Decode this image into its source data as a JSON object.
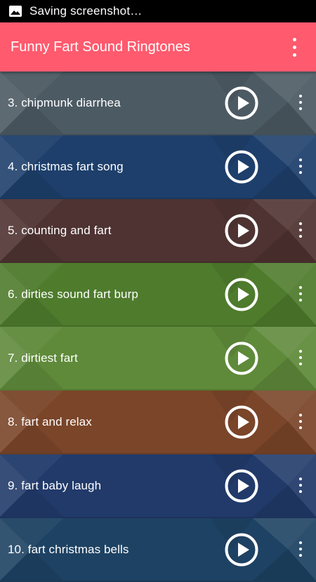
{
  "status_bar": {
    "text": "Saving screenshot…",
    "icon": "image-icon"
  },
  "app_bar": {
    "title": "Funny Fart Sound Ringtones",
    "menu_icon": "overflow-menu-icon"
  },
  "items": [
    {
      "label": "3. chipmunk diarrhea",
      "color": "#4c5a63"
    },
    {
      "label": "4. christmas fart song",
      "color": "#1e3f6b"
    },
    {
      "label": "5. counting and fart",
      "color": "#4e3332"
    },
    {
      "label": "6. dirties sound fart burp",
      "color": "#4e7b2c"
    },
    {
      "label": "7. dirtiest fart",
      "color": "#5f8a3a"
    },
    {
      "label": "8. fart and relax",
      "color": "#7a4529"
    },
    {
      "label": "9. fart baby laugh",
      "color": "#213a6a"
    },
    {
      "label": "10. fart christmas bells",
      "color": "#1e4263"
    }
  ]
}
